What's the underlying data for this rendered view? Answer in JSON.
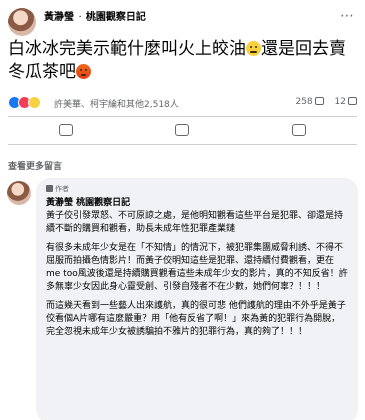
{
  "post": {
    "author": "黃瀞瑩",
    "page": "桃園觀察日記",
    "meta": "⋯",
    "text_part1": "白冰冰完美示範什麼叫火上皎油",
    "text_part2": "還是回去賣冬瓜茶吧",
    "emoji_1": "face-icon",
    "emoji_2": "angry-face-icon"
  },
  "reactions": {
    "names": "許美華、柯宇綸和其他2,518人",
    "comments_count": "258",
    "shares_count": "12"
  },
  "comments": {
    "view_more": "查看更多留言",
    "badge": "作者",
    "author": "黃瀞瑩 桃園觀察日記",
    "paragraphs": [
      "黃子佼引發眾怒、不可原諒之處，是他明知觀看這些平台是犯罪、卻還是持續不斷的購買和觀看，助長未成年性犯罪產業鏈",
      "有很多未成年少女是在「不知情」的情況下，被犯罪集團威脅利誘、不得不屈服而拍攝色情影片！而黃子佼明知這些是犯罪、還持續付費觀看，更在me too風波後還是持續購買觀看這些未成年少女的影片，真的不知反省！許多無辜少女因此身心靈受創、引發自殘者不在少數，她們何辜？！！！",
      "而這幾天看到一些藝人出來護航，真的很可悲 他們護航的理由不外乎是黃子佼看個A片哪有這麼嚴重？用「他有反省了啊！」來為黃的犯罪行為開脫，完全忽視未成年少女被誘騙拍不雅片的犯罪行為，真的夠了！！！"
    ]
  }
}
